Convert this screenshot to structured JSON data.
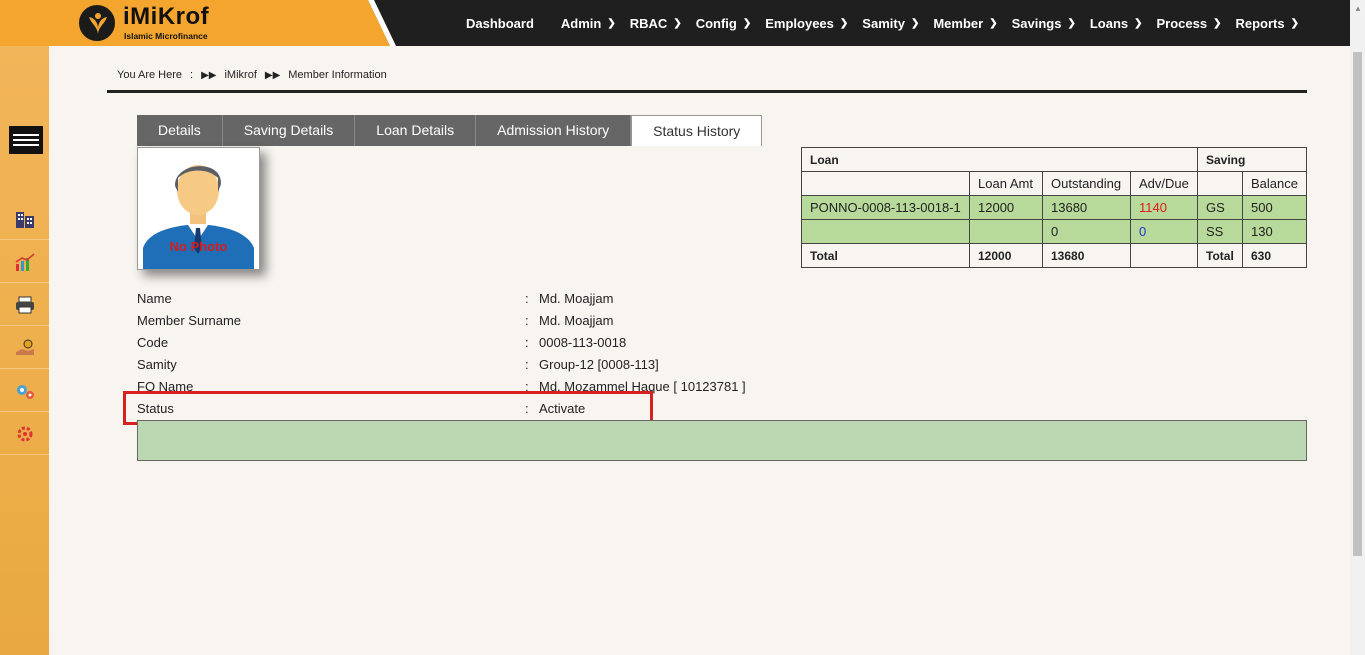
{
  "app": {
    "title": "iMiKrof",
    "subtitle": "Islamic Microfinance"
  },
  "nav": {
    "items": [
      {
        "label": "Dashboard",
        "has_menu": false
      },
      {
        "label": "Admin",
        "has_menu": true
      },
      {
        "label": "RBAC",
        "has_menu": true
      },
      {
        "label": "Config",
        "has_menu": true
      },
      {
        "label": "Employees",
        "has_menu": true
      },
      {
        "label": "Samity",
        "has_menu": true
      },
      {
        "label": "Member",
        "has_menu": true
      },
      {
        "label": "Savings",
        "has_menu": true
      },
      {
        "label": "Loans",
        "has_menu": true
      },
      {
        "label": "Process",
        "has_menu": true
      },
      {
        "label": "Reports",
        "has_menu": true
      }
    ]
  },
  "sidebar": {
    "icons": [
      "building-icon",
      "chart-icon",
      "printer-icon",
      "hand-money-icon",
      "gears-icon",
      "settings-icon"
    ]
  },
  "breadcrumb": {
    "prefix": "You Are Here",
    "colon": ":",
    "items": [
      "iMikrof",
      "Member Information"
    ]
  },
  "tabs": [
    {
      "label": "Details",
      "active": false
    },
    {
      "label": "Saving Details",
      "active": false
    },
    {
      "label": "Loan Details",
      "active": false
    },
    {
      "label": "Admission History",
      "active": false
    },
    {
      "label": "Status History",
      "active": true
    }
  ],
  "photo": {
    "placeholder_text": "No Photo"
  },
  "summary": {
    "loan_header": "Loan",
    "saving_header": "Saving",
    "columns": [
      "Loan Amt",
      "Outstanding",
      "Adv/Due",
      "Balance"
    ],
    "rows": [
      {
        "loan_code": "PONNO-0008-113-0018-1",
        "loan_amt": "12000",
        "outstanding": "13680",
        "adv_due": "1140",
        "saving_type": "GS",
        "balance": "500"
      },
      {
        "loan_code": "",
        "loan_amt": "",
        "outstanding": "0",
        "adv_due": "0",
        "saving_type": "SS",
        "balance": "130"
      }
    ],
    "total": {
      "label": "Total",
      "loan_amt": "12000",
      "outstanding": "13680",
      "adv_due": "",
      "saving_label": "Total",
      "balance": "630"
    }
  },
  "member": {
    "fields": [
      {
        "label": "Name",
        "value": "Md. Moajjam"
      },
      {
        "label": "Member Surname",
        "value": "Md. Moajjam"
      },
      {
        "label": "Code",
        "value": "0008-113-0018"
      },
      {
        "label": "Samity",
        "value": "Group-12 [0008-113]"
      },
      {
        "label": "FO Name",
        "value": "Md. Mozammel Haque [ 10123781 ]"
      },
      {
        "label": "Status",
        "value": "Activate"
      }
    ],
    "separator": ":"
  },
  "colors": {
    "accent": "#f4a52e",
    "header_bg": "#1f1f1f",
    "highlight_box": "#d92020",
    "row_green": "#b7d99a"
  }
}
